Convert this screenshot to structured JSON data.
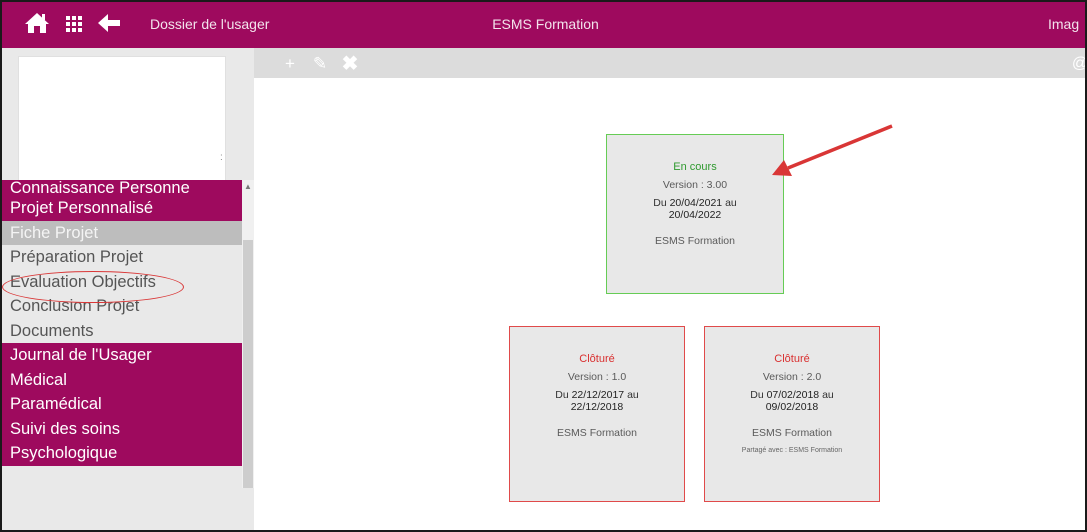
{
  "topbar": {
    "breadcrumb": "Dossier de l'usager",
    "title": "ESMS Formation",
    "right_tab": "Imag",
    "icons": [
      "home-icon",
      "apps-grid-icon",
      "back-arrow-icon"
    ],
    "color": "#9e0a5e"
  },
  "sidebar": {
    "ghost_char": ":",
    "menu": [
      {
        "label": "Connaissance Personne",
        "type": "section"
      },
      {
        "label": "Projet Personnalisé",
        "type": "section"
      },
      {
        "label": "Fiche Projet",
        "type": "active"
      },
      {
        "label": "Préparation Projet",
        "type": "sub"
      },
      {
        "label": "Evaluation Objectifs",
        "type": "sub"
      },
      {
        "label": "Conclusion Projet",
        "type": "sub"
      },
      {
        "label": "Documents",
        "type": "sub"
      },
      {
        "label": "Journal de l'Usager",
        "type": "section"
      },
      {
        "label": "Médical",
        "type": "section"
      },
      {
        "label": "Paramédical",
        "type": "section"
      },
      {
        "label": "Suivi des soins",
        "type": "section"
      },
      {
        "label": "Psychologique",
        "type": "section"
      }
    ]
  },
  "toolbar": {
    "icons": [
      "add-document-icon",
      "edit-pencil-icon",
      "delete-x-icon",
      "at-icon"
    ],
    "add_glyph": "+",
    "edit_glyph": "✎",
    "delete_glyph": "✖",
    "at_glyph": "@"
  },
  "cards": {
    "current": {
      "status": "En cours",
      "version": "Version : 3.00",
      "from_prefix": "Du",
      "from": "20/04/2021",
      "to_prefix": "au",
      "to": "20/04/2022",
      "org": "ESMS Formation"
    },
    "closed1": {
      "status": "Clôturé",
      "version": "Version : 1.0",
      "from_prefix": "Du",
      "from": "22/12/2017",
      "to_prefix": "au",
      "to": "22/12/2018",
      "org": "ESMS Formation"
    },
    "closed2": {
      "status": "Clôturé",
      "version": "Version : 2.0",
      "from_prefix": "Du",
      "from": "07/02/2018",
      "to_prefix": "au",
      "to": "09/02/2018",
      "org": "ESMS Formation",
      "shared": "Partagé avec : ESMS Formation"
    }
  },
  "colors": {
    "accent": "#9e0a5e",
    "current_border": "#66cc55",
    "closed_border": "#e04a4a",
    "annotation": "#d93636"
  }
}
